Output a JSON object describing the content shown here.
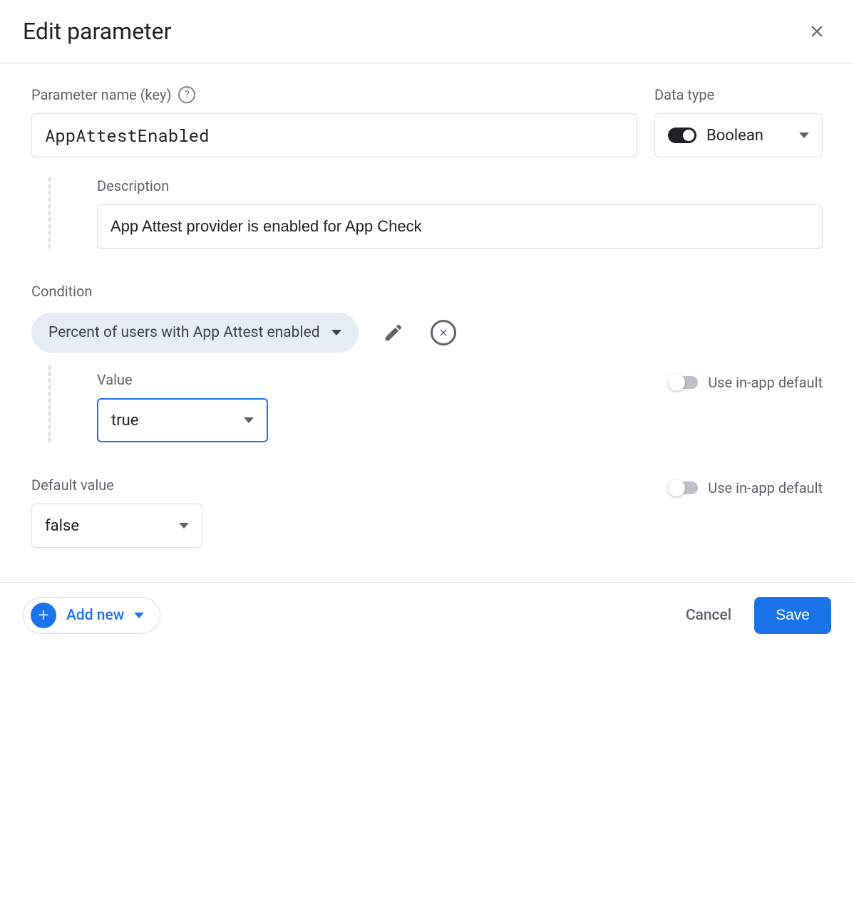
{
  "header": {
    "title": "Edit parameter"
  },
  "param": {
    "name_label": "Parameter name (key)",
    "name_value": "AppAttestEnabled",
    "datatype_label": "Data type",
    "datatype_value": "Boolean"
  },
  "description": {
    "label": "Description",
    "value": "App Attest provider is enabled for App Check"
  },
  "condition": {
    "label": "Condition",
    "chip_text": "Percent of users with App Attest enabled",
    "value_label": "Value",
    "value_selected": "true",
    "use_inapp_label": "Use in-app default"
  },
  "default": {
    "label": "Default value",
    "value_selected": "false",
    "use_inapp_label": "Use in-app default"
  },
  "footer": {
    "add_new": "Add new",
    "cancel": "Cancel",
    "save": "Save"
  }
}
